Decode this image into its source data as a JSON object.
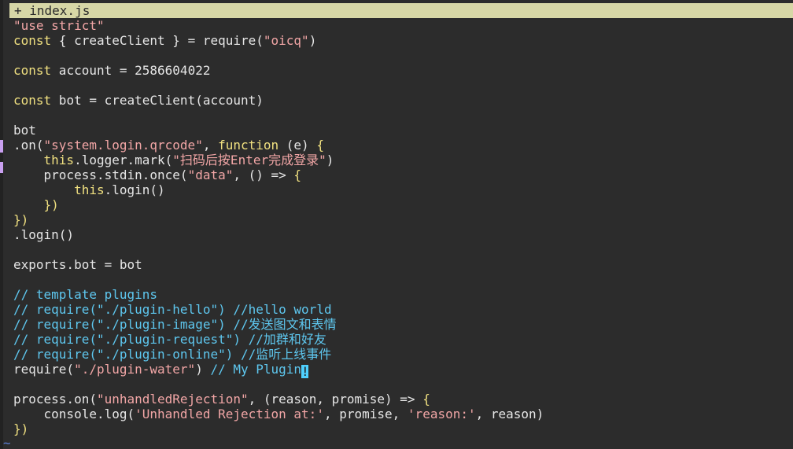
{
  "tab": {
    "label": "+ index.js"
  },
  "colors": {
    "string": "#f2a6a6",
    "keyword": "#f0e080",
    "comment": "#5ec7ef",
    "text": "#e6e6e6",
    "tab_bg": "#d7d7a6",
    "cursor": "#4fd0ff",
    "background": "#2c2c2c"
  },
  "code": {
    "l1": {
      "a": "\"use strict\""
    },
    "l2": {
      "a": "const",
      "b": " { createClient } = require(",
      "c": "\"oicq\"",
      "d": ")"
    },
    "l4": {
      "a": "const",
      "b": " account = 2586604022"
    },
    "l6": {
      "a": "const",
      "b": " bot = createClient(account)"
    },
    "l8": {
      "a": "bot"
    },
    "l9": {
      "a": ".on(",
      "b": "\"system.login.qrcode\"",
      "c": ", ",
      "d": "function",
      "e": " (e) ",
      "f": "{"
    },
    "l10": {
      "a": "    ",
      "b": "this",
      "c": ".logger.mark(",
      "d": "\"扫码后按Enter完成登录\"",
      "e": ")"
    },
    "l11": {
      "a": "    process.stdin.once(",
      "b": "\"data\"",
      "c": ", () => ",
      "d": "{"
    },
    "l12": {
      "a": "        ",
      "b": "this",
      "c": ".login()"
    },
    "l13": {
      "a": "    ",
      "b": "})"
    },
    "l14": {
      "a": "})"
    },
    "l15": {
      "a": ".login()"
    },
    "l17": {
      "a": "exports.bot = bot"
    },
    "l19": {
      "a": "// template plugins"
    },
    "l20": {
      "a": "// require(\"./plugin-hello\") //hello world"
    },
    "l21": {
      "a": "// require(\"./plugin-image\") //发送图文和表情"
    },
    "l22": {
      "a": "// require(\"./plugin-request\") //加群和好友"
    },
    "l23": {
      "a": "// require(\"./plugin-online\") //监听上线事件"
    },
    "l24": {
      "a": "require(",
      "b": "\"./plugin-water\"",
      "c": ") ",
      "d": "// My Plugin",
      "e": "!"
    },
    "l26": {
      "a": "process.on(",
      "b": "\"unhandledRejection\"",
      "c": ", (reason, promise) => ",
      "d": "{"
    },
    "l27": {
      "a": "    console.log(",
      "b": "'Unhandled Rejection at:'",
      "c": ", promise, ",
      "d": "'reason:'",
      "e": ", reason)"
    },
    "l28": {
      "a": "})"
    }
  },
  "status": {
    "tilde": "~"
  }
}
